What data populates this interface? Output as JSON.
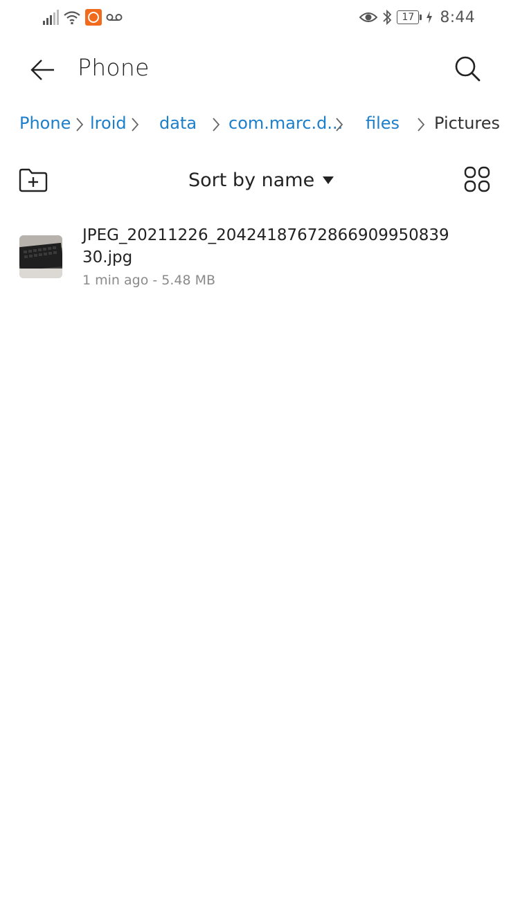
{
  "status_bar": {
    "time": "8:44",
    "battery": "17",
    "icons": [
      "signal-icon",
      "wifi-icon",
      "vpn-icon",
      "voicemail-icon",
      "eye-icon",
      "bluetooth-icon",
      "battery-icon",
      "charging-icon"
    ]
  },
  "header": {
    "title": "Phone",
    "back_icon": "back-arrow-icon",
    "search_icon": "search-icon"
  },
  "breadcrumb": {
    "items": [
      {
        "label": "Phone"
      },
      {
        "label": "lroid"
      },
      {
        "label": "data"
      },
      {
        "label": "com.marc.d..."
      },
      {
        "label": "files"
      },
      {
        "label": "Pictures"
      }
    ]
  },
  "toolbar": {
    "sort_label": "Sort by name",
    "new_folder_icon": "new-folder-icon",
    "grid_view_icon": "grid-view-icon"
  },
  "files": [
    {
      "name": "JPEG_20211226_2042418767286690995083930.jpg",
      "meta": "1 min ago - 5.48 MB"
    }
  ],
  "colors": {
    "link": "#1b7fcc",
    "vpn_badge": "#f26b1d",
    "meta_text": "#8a8a8a"
  }
}
